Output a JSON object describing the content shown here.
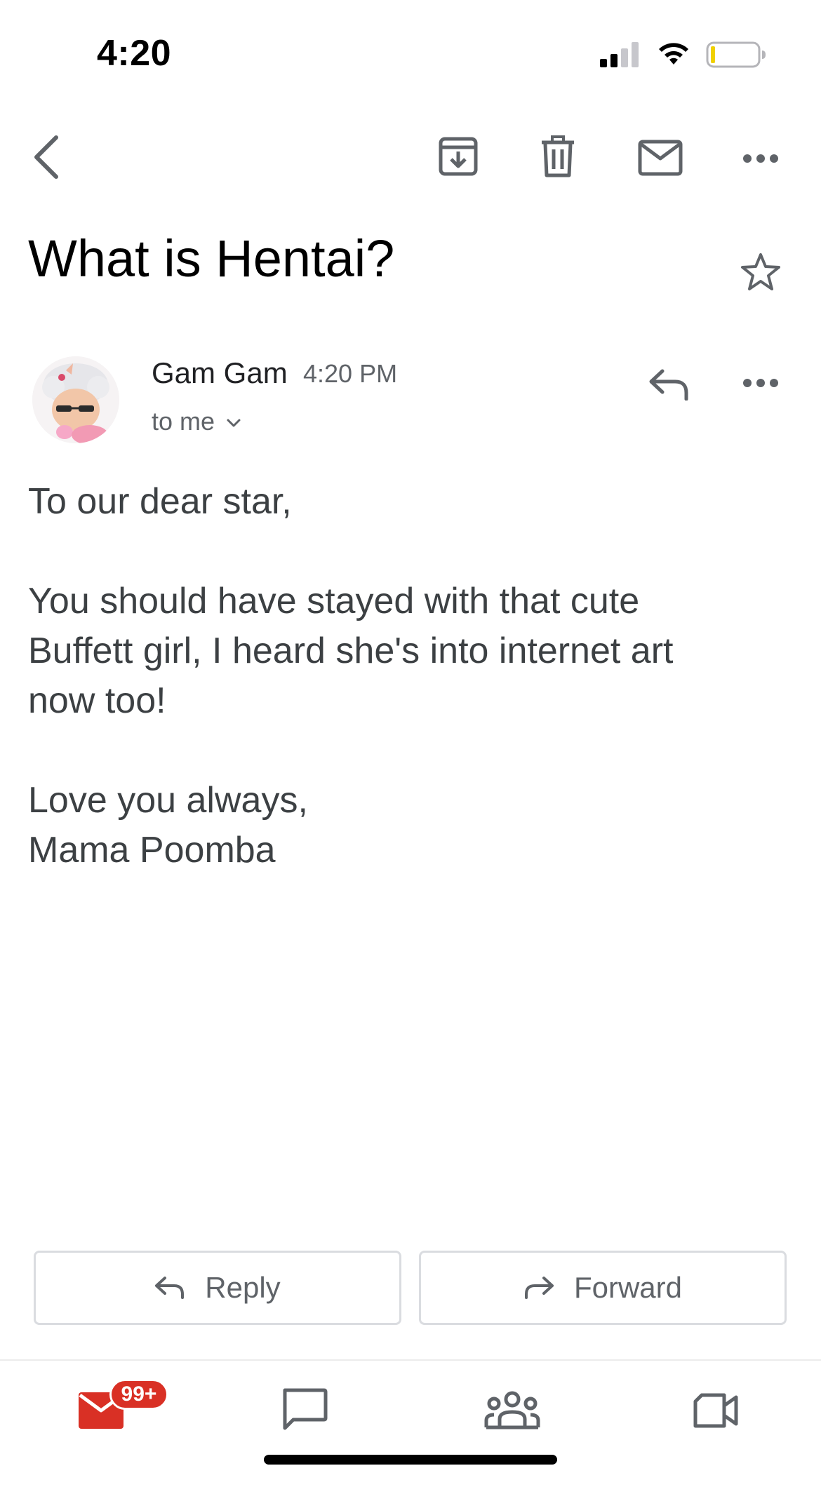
{
  "status_bar": {
    "time": "4:20",
    "icons": [
      "cellular-signal-icon",
      "wifi-icon",
      "battery-icon"
    ]
  },
  "toolbar": {
    "icons": [
      "back-arrow-icon",
      "archive-icon",
      "delete-icon",
      "mark-unread-icon",
      "more-options-icon"
    ]
  },
  "email": {
    "subject": "What is Hentai?",
    "starred": false,
    "sender_name": "Gam Gam",
    "time": "4:20 PM",
    "recipient": "to me",
    "body": {
      "greeting": "To our dear star,",
      "line1": "You should have stayed with that cute",
      "line2": "Buffett girl, I heard she's into internet art",
      "line3": "now too!",
      "closing": "Love you always,",
      "signature": "Mama Poomba"
    }
  },
  "actions": {
    "reply_label": "Reply",
    "forward_label": "Forward"
  },
  "bottom_nav": {
    "mail_badge": "99+",
    "items": [
      "mail-icon",
      "chat-icon",
      "spaces-icon",
      "meet-icon"
    ]
  },
  "colors": {
    "accent_red": "#d93025",
    "text_primary": "#202124",
    "text_secondary": "#5f6368",
    "border": "#dadce0"
  }
}
